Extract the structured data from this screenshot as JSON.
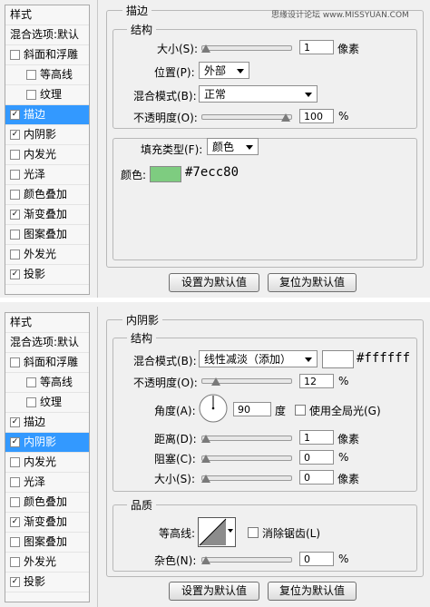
{
  "watermark": "思缘设计论坛  www.MISSYUAN.COM",
  "panel1": {
    "styles_header": "样式",
    "blend_options": "混合选项:默认",
    "items": [
      {
        "label": "斜面和浮雕",
        "checked": false,
        "indent": false,
        "selected": false
      },
      {
        "label": "等高线",
        "checked": false,
        "indent": true,
        "selected": false
      },
      {
        "label": "纹理",
        "checked": false,
        "indent": true,
        "selected": false
      },
      {
        "label": "描边",
        "checked": true,
        "indent": false,
        "selected": true
      },
      {
        "label": "内阴影",
        "checked": true,
        "indent": false,
        "selected": false
      },
      {
        "label": "内发光",
        "checked": false,
        "indent": false,
        "selected": false
      },
      {
        "label": "光泽",
        "checked": false,
        "indent": false,
        "selected": false
      },
      {
        "label": "颜色叠加",
        "checked": false,
        "indent": false,
        "selected": false
      },
      {
        "label": "渐变叠加",
        "checked": true,
        "indent": false,
        "selected": false
      },
      {
        "label": "图案叠加",
        "checked": false,
        "indent": false,
        "selected": false
      },
      {
        "label": "外发光",
        "checked": false,
        "indent": false,
        "selected": false
      },
      {
        "label": "投影",
        "checked": true,
        "indent": false,
        "selected": false
      }
    ],
    "title": "描边",
    "structure": "结构",
    "size_label": "大小(S):",
    "size_value": "1",
    "size_unit": "像素",
    "size_level": 0.0,
    "position_label": "位置(P):",
    "position_value": "外部",
    "blend_label": "混合模式(B):",
    "blend_value": "正常",
    "opacity_label": "不透明度(O):",
    "opacity_value": "100",
    "opacity_unit": "%",
    "opacity_level": 1.0,
    "fill_type_label": "填充类型(F):",
    "fill_type_value": "颜色",
    "color_label": "颜色:",
    "color_hex_text": "#7ecc80",
    "color_swatch": "#7ecc80",
    "btn_default": "设置为默认值",
    "btn_reset": "复位为默认值"
  },
  "panel2": {
    "styles_header": "样式",
    "blend_options": "混合选项:默认",
    "items": [
      {
        "label": "斜面和浮雕",
        "checked": false,
        "indent": false,
        "selected": false
      },
      {
        "label": "等高线",
        "checked": false,
        "indent": true,
        "selected": false
      },
      {
        "label": "纹理",
        "checked": false,
        "indent": true,
        "selected": false
      },
      {
        "label": "描边",
        "checked": true,
        "indent": false,
        "selected": false
      },
      {
        "label": "内阴影",
        "checked": true,
        "indent": false,
        "selected": true
      },
      {
        "label": "内发光",
        "checked": false,
        "indent": false,
        "selected": false
      },
      {
        "label": "光泽",
        "checked": false,
        "indent": false,
        "selected": false
      },
      {
        "label": "颜色叠加",
        "checked": false,
        "indent": false,
        "selected": false
      },
      {
        "label": "渐变叠加",
        "checked": true,
        "indent": false,
        "selected": false
      },
      {
        "label": "图案叠加",
        "checked": false,
        "indent": false,
        "selected": false
      },
      {
        "label": "外发光",
        "checked": false,
        "indent": false,
        "selected": false
      },
      {
        "label": "投影",
        "checked": true,
        "indent": false,
        "selected": false
      }
    ],
    "title": "内阴影",
    "structure": "结构",
    "blend_label": "混合模式(B):",
    "blend_value": "线性减淡（添加）",
    "blend_color_hex": "#ffffff",
    "blend_swatch": "#ffffff",
    "opacity_label": "不透明度(O):",
    "opacity_value": "12",
    "opacity_unit": "%",
    "opacity_level": 0.12,
    "angle_label": "角度(A):",
    "angle_value": "90",
    "angle_unit": "度",
    "global_light_label": "使用全局光(G)",
    "distance_label": "距离(D):",
    "distance_value": "1",
    "distance_unit": "像素",
    "distance_level": 0.0,
    "choke_label": "阻塞(C):",
    "choke_value": "0",
    "choke_unit": "%",
    "choke_level": 0.0,
    "size_label": "大小(S):",
    "size_value": "0",
    "size_unit": "像素",
    "size_level": 0.0,
    "quality": "品质",
    "contour_label": "等高线:",
    "antialias_label": "消除锯齿(L)",
    "noise_label": "杂色(N):",
    "noise_value": "0",
    "noise_unit": "%",
    "noise_level": 0.0,
    "btn_default": "设置为默认值",
    "btn_reset": "复位为默认值"
  }
}
